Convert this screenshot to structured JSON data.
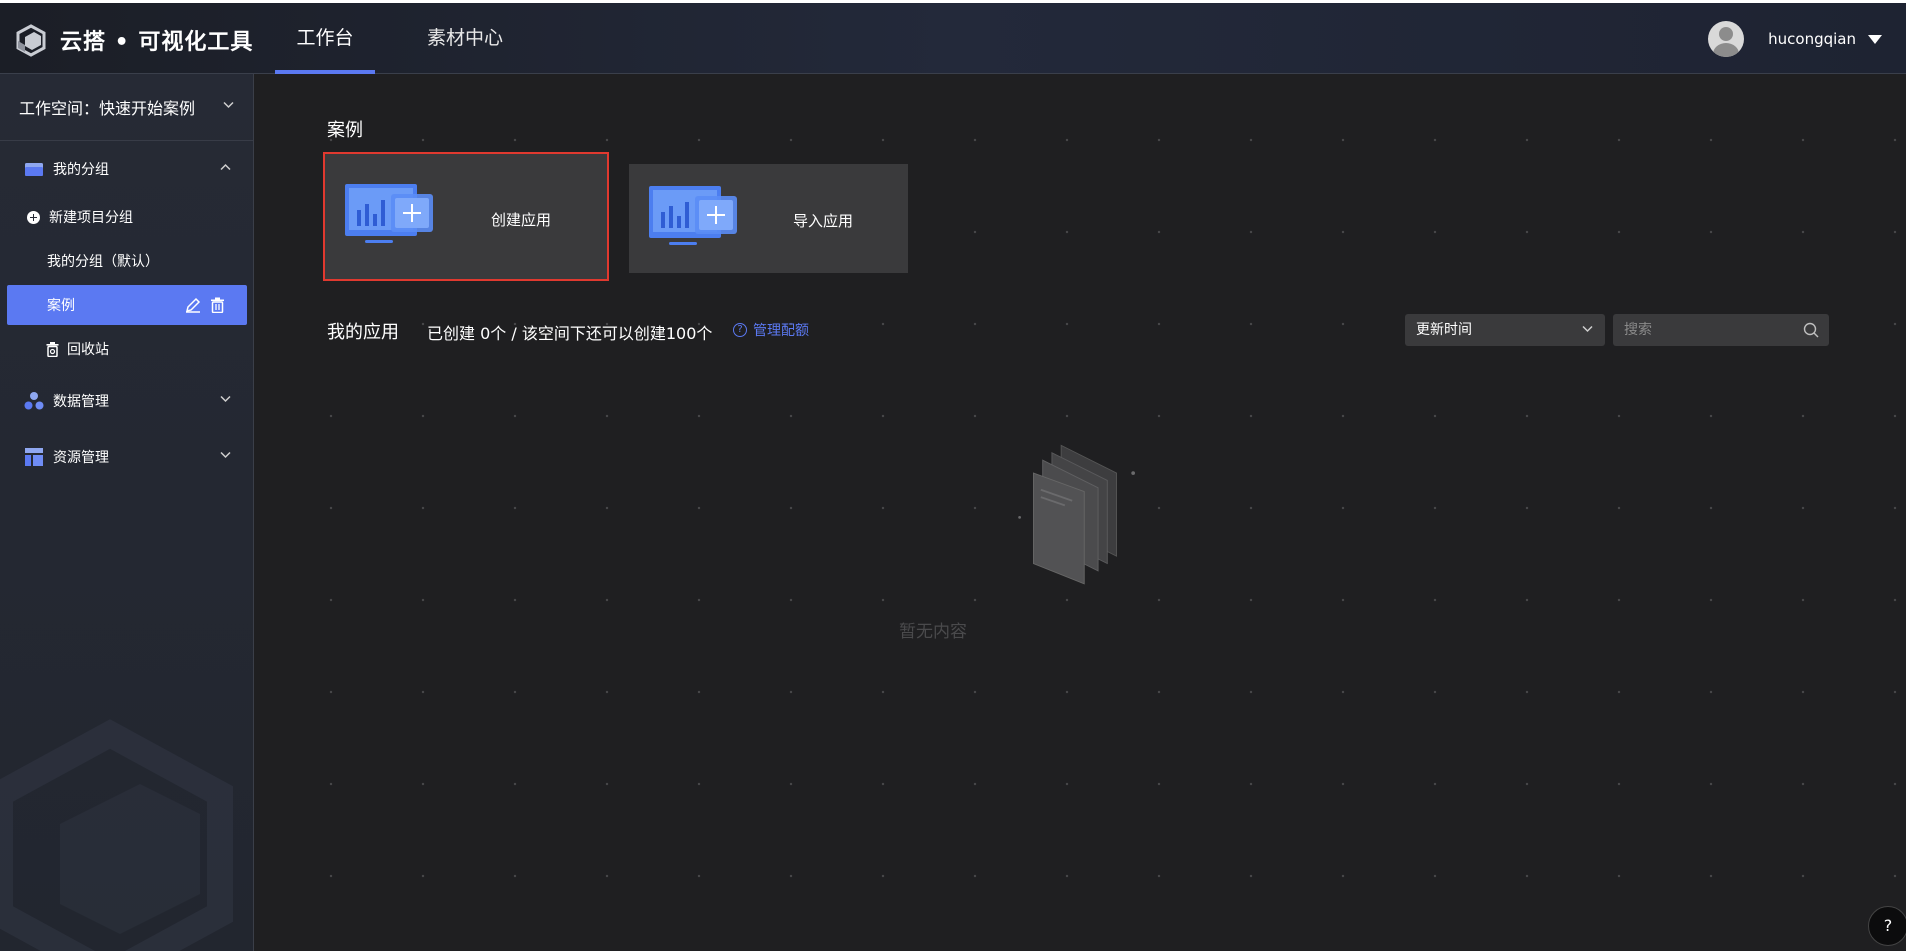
{
  "header": {
    "brand": "云搭 • 可视化工具",
    "tabs": [
      {
        "label": "工作台",
        "active": true
      },
      {
        "label": "素材中心",
        "active": false
      }
    ],
    "user": {
      "name": "hucongqian"
    }
  },
  "sidebar": {
    "workspace_label": "工作空间：快速开始案例",
    "groups": [
      {
        "label": "我的分组",
        "icon": "folder-icon",
        "expanded": true
      },
      {
        "label": "数据管理",
        "icon": "data-nodes-icon",
        "expanded": false
      },
      {
        "label": "资源管理",
        "icon": "layout-icon",
        "expanded": false
      }
    ],
    "new_group_label": "新建项目分组",
    "items": [
      {
        "label": "我的分组（默认）"
      },
      {
        "label": "案例",
        "active": true
      },
      {
        "label": "回收站",
        "icon": "trash-icon"
      }
    ]
  },
  "main": {
    "section_title": "案例",
    "cards": [
      {
        "label": "创建应用",
        "icon": "create-app-icon"
      },
      {
        "label": "导入应用",
        "icon": "import-app-icon"
      }
    ],
    "apps_title": "我的应用",
    "apps_info": "已创建 0个 / 该空间下还可以创建100个",
    "quota_link": "管理配额",
    "sort": {
      "selected": "更新时间"
    },
    "search": {
      "placeholder": "搜索"
    },
    "empty_text": "暂无内容"
  },
  "help_fab": "?",
  "colors": {
    "accent": "#5b79f2",
    "highlight_border": "#e0392f",
    "background": "#1f1f21",
    "card": "#3a3a3c"
  }
}
